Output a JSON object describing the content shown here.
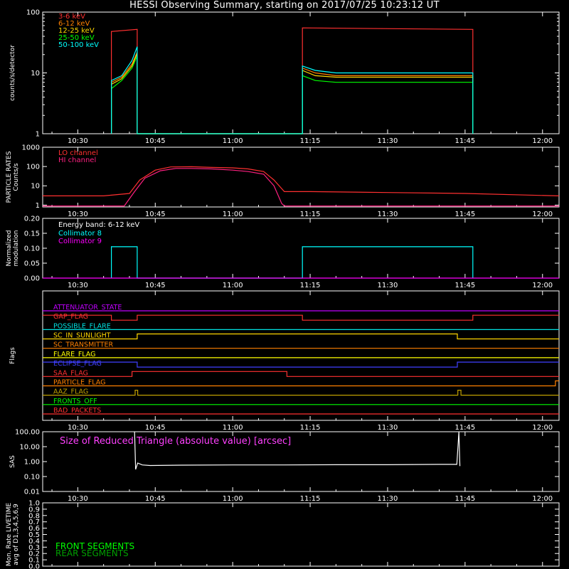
{
  "title": "HESSI Observing Summary, starting on 2017/07/25 10:23:12 UT",
  "time_ticks": [
    "10:30",
    "10:45",
    "11:00",
    "11:15",
    "11:30",
    "11:45",
    "12:00"
  ],
  "time_tick_minutes": [
    30,
    45,
    60,
    75,
    90,
    105,
    120
  ],
  "time_range_minutes": [
    23.2,
    123.2
  ],
  "chart_data": [
    {
      "id": "count-rates",
      "type": "line",
      "ylabel": "counts/s/detector",
      "yscale": "log",
      "ylim": [
        1,
        100
      ],
      "yticks": [
        "1",
        "10",
        "100"
      ],
      "legend_position": "top-left",
      "series": [
        {
          "name": "3-6 keV",
          "color": "#ff3030",
          "x": [
            36.5,
            36.5,
            41.5,
            41.5,
            73.5,
            73.5,
            106.5,
            106.5
          ],
          "y": [
            1,
            48,
            52,
            1,
            1,
            55,
            52,
            1
          ]
        },
        {
          "name": "6-12 keV",
          "color": "#ff8000",
          "x": [
            36.5,
            36.5,
            38.5,
            40.5,
            41.5,
            41.5,
            73.5,
            73.5,
            76,
            80,
            106.5,
            106.5
          ],
          "y": [
            1,
            7,
            8.5,
            14,
            22,
            1,
            1,
            12,
            10,
            9,
            9,
            1
          ]
        },
        {
          "name": "12-25 keV",
          "color": "#ffd700",
          "x": [
            36.5,
            36.5,
            38.5,
            40.5,
            41.5,
            41.5,
            73.5,
            73.5,
            76,
            80,
            106.5,
            106.5
          ],
          "y": [
            1,
            6.5,
            8,
            13,
            21,
            1,
            1,
            11,
            9,
            8.5,
            8.5,
            1
          ]
        },
        {
          "name": "25-50 keV",
          "color": "#00ff00",
          "x": [
            36.5,
            36.5,
            38.5,
            40.5,
            41.5,
            41.5,
            73.5,
            73.5,
            76,
            80,
            106.5,
            106.5
          ],
          "y": [
            1,
            5.5,
            7.5,
            12,
            19,
            1,
            1,
            9,
            7.5,
            7,
            7,
            1
          ]
        },
        {
          "name": "50-100 keV",
          "color": "#00ffff",
          "x": [
            36.5,
            36.5,
            38.5,
            40.5,
            41.5,
            41.5,
            73.5,
            73.5,
            76,
            80,
            106.5,
            106.5
          ],
          "y": [
            1,
            7.5,
            9,
            16,
            27,
            1,
            1,
            13,
            11,
            10,
            10,
            1
          ]
        }
      ]
    },
    {
      "id": "particle-rates",
      "type": "line",
      "ylabel": "PARTICLE RATES Counts/s",
      "yscale": "log",
      "ylim": [
        0.8,
        1000
      ],
      "yticks": [
        "1",
        "10",
        "100",
        "1000"
      ],
      "legend_position": "top-left",
      "series": [
        {
          "name": "LO channel",
          "color": "#ff3030",
          "x": [
            23.2,
            35,
            40,
            42,
            45,
            48,
            52,
            56,
            60,
            63,
            66,
            68,
            70,
            75,
            90,
            105,
            123.2
          ],
          "y": [
            3,
            3,
            4,
            20,
            65,
            95,
            98,
            90,
            85,
            75,
            55,
            20,
            5,
            5,
            4.5,
            4,
            3
          ]
        },
        {
          "name": "HI channel",
          "color": "#ff2080",
          "x": [
            23.2,
            39,
            41,
            43,
            46,
            49,
            52,
            56,
            60,
            63,
            66,
            68,
            69.5,
            70,
            123.2
          ],
          "y": [
            0.9,
            0.9,
            5,
            25,
            60,
            80,
            80,
            75,
            65,
            55,
            40,
            10,
            1.2,
            0.9,
            0.9
          ]
        }
      ]
    },
    {
      "id": "modulation",
      "type": "line",
      "ylabel": "Normalized modulation",
      "ylim": [
        0,
        0.2
      ],
      "yticks": [
        "0.00",
        "0.05",
        "0.10",
        "0.15",
        "0.20"
      ],
      "legend_position": "top-left",
      "annotation": "Energy band: 6-12 keV",
      "series": [
        {
          "name": "Collimator 8",
          "color": "#00ffff",
          "x": [
            36.5,
            36.5,
            41.5,
            41.5,
            73.5,
            73.5,
            106.5,
            106.5
          ],
          "y": [
            0,
            0.105,
            0.105,
            0,
            0,
            0.105,
            0.105,
            0
          ]
        },
        {
          "name": "Collimator 9",
          "color": "#ff00ff",
          "x": [
            23.2,
            123.2
          ],
          "y": [
            0,
            0
          ]
        }
      ]
    },
    {
      "id": "flags",
      "type": "line",
      "ylabel": "Flags",
      "series": [
        {
          "name": "ATTENUATOR_STATE",
          "color": "#c000ff",
          "x": [
            23.2,
            123.2
          ],
          "y": [
            0,
            0
          ]
        },
        {
          "name": "GAP_FLAG",
          "color": "#ff3030",
          "x": [
            23.2,
            36.5,
            36.5,
            41.5,
            41.5,
            73.5,
            73.5,
            106.5,
            106.5,
            123.2
          ],
          "y": [
            1,
            1,
            0,
            0,
            1,
            1,
            0,
            0,
            1,
            1
          ]
        },
        {
          "name": "POSSIBLE_FLARE",
          "color": "#00e0e0",
          "x": [
            23.2,
            123.2
          ],
          "y": [
            0,
            0
          ]
        },
        {
          "name": "SC_IN_SUNLIGHT",
          "color": "#ffd700",
          "x": [
            23.2,
            41.5,
            41.5,
            103.5,
            103.5,
            123.2
          ],
          "y": [
            0,
            0,
            1,
            1,
            0,
            0
          ]
        },
        {
          "name": "SC_TRANSMITTER",
          "color": "#ff8000",
          "x": [
            23.2,
            123.2
          ],
          "y": [
            0,
            0
          ]
        },
        {
          "name": "FLARE_FLAG",
          "color": "#ffff00",
          "x": [
            23.2,
            123.2
          ],
          "y": [
            0,
            0
          ]
        },
        {
          "name": "ECLIPSE_FLAG",
          "color": "#4040ff",
          "x": [
            23.2,
            41.5,
            41.5,
            103.5,
            103.5,
            123.2
          ],
          "y": [
            1,
            1,
            0,
            0,
            1,
            1
          ]
        },
        {
          "name": "SAA_FLAG",
          "color": "#ff3030",
          "x": [
            23.2,
            40.5,
            40.5,
            70.5,
            70.5,
            123.2
          ],
          "y": [
            0,
            0,
            1,
            1,
            0,
            0
          ]
        },
        {
          "name": "PARTICLE_FLAG",
          "color": "#ff8000",
          "x": [
            23.2,
            122.5,
            122.5,
            123.2
          ],
          "y": [
            0,
            0,
            1,
            1
          ]
        },
        {
          "name": "AAZ_FLAG",
          "color": "#c0a000",
          "x": [
            23.2,
            41.1,
            41.1,
            41.6,
            41.6,
            103.6,
            103.6,
            104.2,
            104.2,
            123.2
          ],
          "y": [
            0,
            0,
            1,
            1,
            0,
            0,
            1,
            1,
            0,
            0
          ]
        },
        {
          "name": "FRONTS_OFF",
          "color": "#00ff00",
          "x": [
            23.2,
            123.2
          ],
          "y": [
            0,
            0
          ]
        },
        {
          "name": "BAD_PACKETS",
          "color": "#ff3030",
          "x": [
            23.2,
            123.2
          ],
          "y": [
            0,
            0
          ]
        }
      ]
    },
    {
      "id": "sas",
      "type": "line",
      "ylabel": "SAS",
      "yscale": "log",
      "ylim": [
        0.01,
        100
      ],
      "yticks": [
        "0.01",
        "0.10",
        "1.00",
        "10.00",
        "100.00"
      ],
      "annotation": "Size of Reduced Triangle (absolute value) [arcsec]",
      "series": [
        {
          "name": "Size of Reduced Triangle",
          "color": "#ffffff",
          "x": [
            41.0,
            41.2,
            41.6,
            42.5,
            44,
            50,
            60,
            70,
            80,
            90,
            100,
            103.4,
            103.8,
            104.0
          ],
          "y": [
            100,
            0.3,
            0.8,
            0.6,
            0.55,
            0.58,
            0.6,
            0.6,
            0.62,
            0.62,
            0.65,
            0.65,
            100,
            0.5
          ]
        }
      ]
    },
    {
      "id": "livetime",
      "type": "line",
      "ylabel": "Mon. Rate LIVETIME avg of D1,3,4,5,6,9",
      "ylim": [
        0,
        1
      ],
      "yticks": [
        "0.0",
        "0.1",
        "0.2",
        "0.3",
        "0.4",
        "0.5",
        "0.6",
        "0.7",
        "0.8",
        "0.9",
        "1.0"
      ],
      "legend_position": "bottom-left",
      "series": [
        {
          "name": "FRONT SEGMENTS",
          "color": "#00ff00",
          "x": [],
          "y": []
        },
        {
          "name": "REAR SEGMENTS",
          "color": "#00a000",
          "x": [],
          "y": []
        }
      ]
    }
  ]
}
